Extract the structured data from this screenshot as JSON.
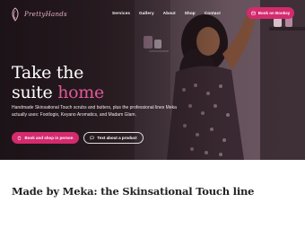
{
  "header": {
    "logo_text": "PrettyHands",
    "nav": [
      {
        "label": "Services"
      },
      {
        "label": "Gallery"
      },
      {
        "label": "About"
      },
      {
        "label": "Shop"
      },
      {
        "label": "Contact"
      }
    ],
    "cta_label": "Book on Booksy"
  },
  "hero": {
    "title_line1": "Take the",
    "title_line2_plain": "suite",
    "title_line2_accent": "home",
    "description": "Handmade Skinsational Touch scrubs and butters, plus the professional lines Meka actually uses: Footlogix, Keyano Aromatics, and Madam Glam.",
    "primary_button": "Book and shop in person",
    "secondary_button": "Text about a product"
  },
  "section": {
    "title": "Made by Meka: the Skinsational Touch line"
  },
  "colors": {
    "accent": "#d42a6e",
    "accent_text": "#e0589a",
    "hero_dark": "#2a1e24"
  },
  "icons": [
    "logo-mark-icon",
    "calendar-icon",
    "bag-icon",
    "chat-icon"
  ]
}
